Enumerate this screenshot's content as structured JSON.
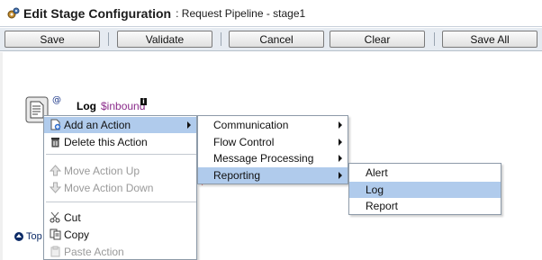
{
  "titlebar": {
    "title": "Edit Stage Configuration",
    "subtitle": ": Request Pipeline - stage1",
    "icon": "gears-icon"
  },
  "toolbar": {
    "save_label": "Save",
    "validate_label": "Validate",
    "cancel_label": "Cancel",
    "clear_label": "Clear",
    "save_all_label": "Save All"
  },
  "stage_action": {
    "at_sign": "@",
    "label": "Log",
    "variable": "$inbound",
    "info_badge": "i",
    "required_marker": "*"
  },
  "footer": {
    "top_link": "Top"
  },
  "context_menu": {
    "items": [
      {
        "label": "Add an Action",
        "icon": "add-action-icon",
        "submenu": true,
        "highlighted": true,
        "enabled": true
      },
      {
        "label": "Delete this Action",
        "icon": "trash-icon",
        "enabled": true
      },
      {
        "label": "Move Action Up",
        "icon": "arrow-up-icon",
        "enabled": false
      },
      {
        "label": "Move Action Down",
        "icon": "arrow-down-icon",
        "enabled": false
      },
      {
        "label": "Cut",
        "icon": "scissors-icon",
        "enabled": true
      },
      {
        "label": "Copy",
        "icon": "copy-icon",
        "enabled": true
      },
      {
        "label": "Paste Action",
        "icon": "paste-icon",
        "enabled": false
      }
    ]
  },
  "add_action_submenu": {
    "items": [
      {
        "label": "Communication",
        "submenu": true
      },
      {
        "label": "Flow Control",
        "submenu": true
      },
      {
        "label": "Message Processing",
        "submenu": true
      },
      {
        "label": "Reporting",
        "submenu": true,
        "highlighted": true
      }
    ]
  },
  "reporting_submenu": {
    "items": [
      {
        "label": "Alert"
      },
      {
        "label": "Log",
        "highlighted": true
      },
      {
        "label": "Report"
      }
    ]
  },
  "colors": {
    "highlight": "#b0cbec",
    "toolbar_bg": "#e6ebf1",
    "variable": "#8b2c8b",
    "link": "#0b2a66",
    "required": "#cc0000"
  }
}
